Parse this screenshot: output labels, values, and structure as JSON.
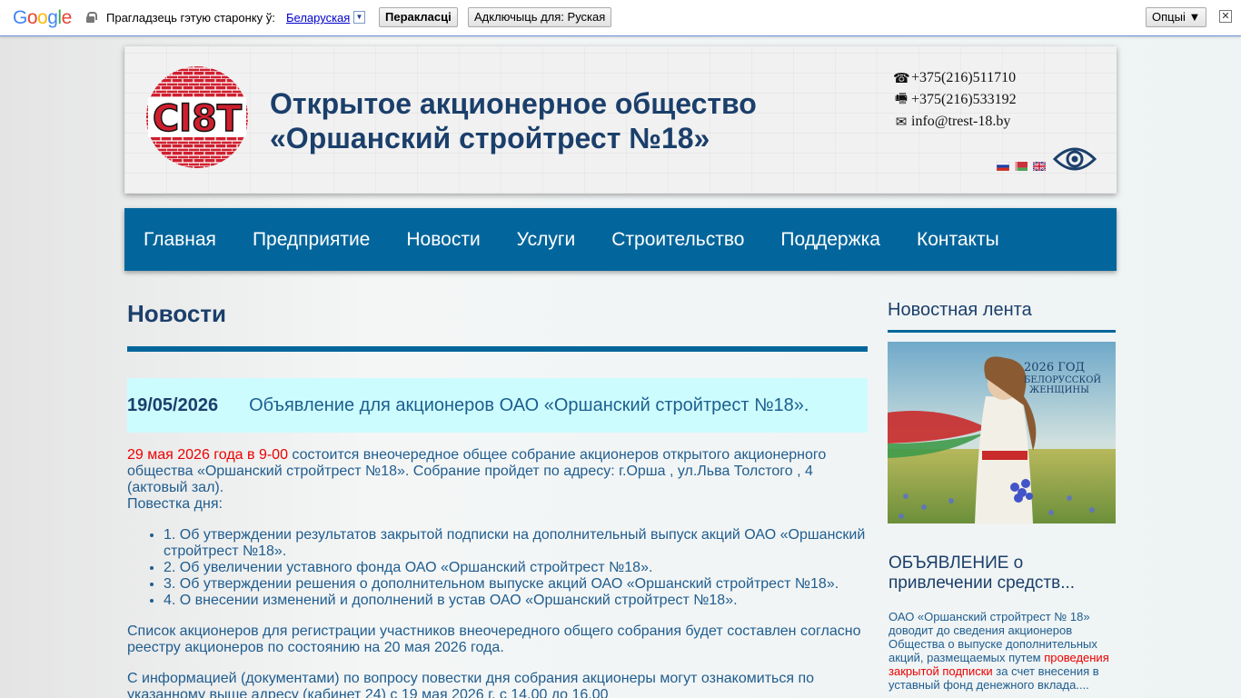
{
  "translate_bar": {
    "logo": "Google",
    "prompt": "Прагладзець гэтую старонку ў:",
    "language": "Беларуская",
    "translate_button": "Перакласці",
    "turn_off_button": "Адключыць для: Руская",
    "options_button": "Опцыі ▼",
    "close": "✕"
  },
  "header": {
    "company_line1": "Открытое акционерное общество",
    "company_line2": "«Оршанский стройтрест №18»",
    "phone": "+375(216)511710",
    "fax": "+375(216)533192",
    "email": "info@trest-18.by",
    "logo_text": "Cl8T"
  },
  "nav": {
    "items": [
      "Главная",
      "Предприятие",
      "Новости",
      "Услуги",
      "Строительство",
      "Поддержка",
      "Контакты"
    ]
  },
  "main": {
    "title": "Новости",
    "news_date": "19/05/2026",
    "news_title": "Объявление для акционеров ОАО «Оршанский стройтрест №18».",
    "intro_red": "29 мая 2026 года в 9-00",
    "intro_rest": " состоится внеочередное общее собрание акционеров открытого акционерного общества «Оршанский стройтрест №18». Собрание пройдет по адресу: г.Орша , ул.Льва Толстого , 4 (актовый зал).",
    "agenda_label": "Повестка дня:",
    "agenda": [
      "1. Об утверждении результатов закрытой подписки на дополнительный выпуск акций ОАО «Оршанский стройтрест №18».",
      "2. Об увеличении уставного фонда ОАО «Оршанский стройтрест №18».",
      "3. Об утверждении решения о дополнительном выпуске акций ОАО «Оршанский стройтрест №18».",
      "4. О внесении изменений и дополнений в устав ОАО «Оршанский стройтрест №18»."
    ],
    "para2": "Список акционеров для регистрации участников внеочередного общего собрания будет составлен согласно реестру акционеров по состоянию на 20 мая 2026 года.",
    "para3": "С информацией (документами) по вопросу повестки дня собрания акционеры могут ознакомиться по указанному выше адресу (кабинет 24) с 19 мая 2026 г. с 14.00 до 16.00"
  },
  "sidebar": {
    "title": "Новостная лента",
    "image_caption_line1": "2026 ГОД",
    "image_caption_line2": "БЕЛОРУССКОЙ",
    "image_caption_line3": "ЖЕНЩИНЫ",
    "subtitle": "ОБЪЯВЛЕНИЕ о привлечении средств...",
    "text_before": "ОАО «Оршанский стройтрест № 18» доводит до сведения акционеров Общества о выпуске дополнительных акций, размещаемых путем ",
    "text_red": "проведения закрытой подписки",
    "text_after": " за счет внесения в уставный фонд денежного вклада...."
  },
  "colors": {
    "nav_bg": "#02669c",
    "title_text": "#1b3f6b",
    "body_text": "#1f5d8f",
    "highlight_red": "#ee0000",
    "news_head_bg": "#cdfcff"
  }
}
